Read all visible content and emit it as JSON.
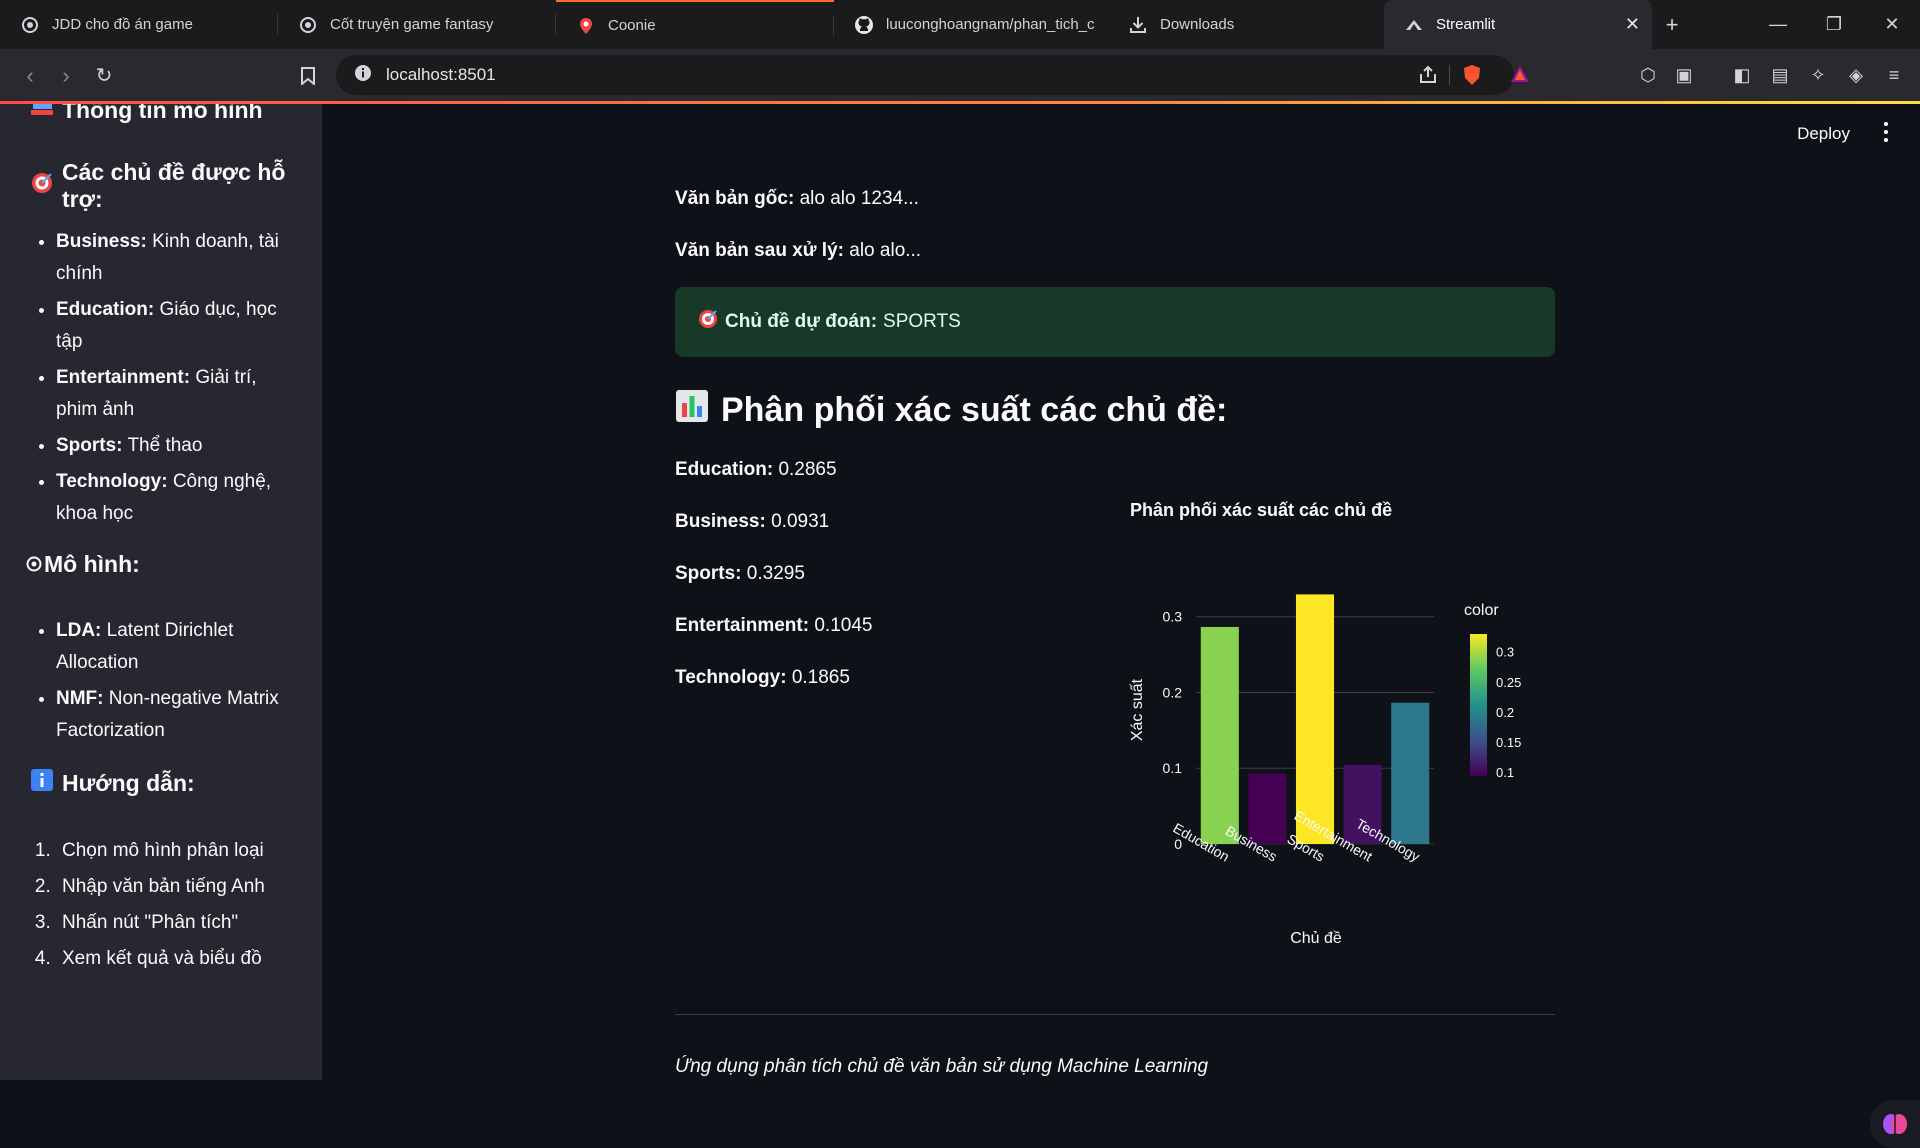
{
  "browser": {
    "tabs": [
      {
        "title": "JDD cho đồ án game",
        "icon": "circle-logo-icon"
      },
      {
        "title": "Cốt truyện game fantasy",
        "icon": "circle-logo-icon"
      },
      {
        "title": "Coonie",
        "icon": "pin-icon"
      },
      {
        "title": "luuconghoangnam/phan_tich_c",
        "icon": "github-icon"
      },
      {
        "title": "Downloads",
        "icon": "download-icon"
      },
      {
        "title": "Streamlit",
        "icon": "streamlit-icon",
        "active": true
      }
    ],
    "url": "localhost:8501"
  },
  "sidebar": {
    "model_info_heading": "Thông tin mô hình",
    "topics_heading": "Các chủ đề được hỗ trợ:",
    "topics": [
      {
        "name": "Business:",
        "desc": "Kinh doanh, tài chính"
      },
      {
        "name": "Education:",
        "desc": "Giáo dục, học tập"
      },
      {
        "name": "Entertainment:",
        "desc": "Giải trí, phim ảnh"
      },
      {
        "name": "Sports:",
        "desc": "Thể thao"
      },
      {
        "name": "Technology:",
        "desc": "Công nghệ, khoa học"
      }
    ],
    "models_heading": "Mô hình:",
    "models": [
      {
        "name": "LDA:",
        "desc": "Latent Dirichlet Allocation"
      },
      {
        "name": "NMF:",
        "desc": "Non-negative Matrix Factorization"
      }
    ],
    "guide_heading": "Hướng dẫn:",
    "guide_steps": [
      "Chọn mô hình phân loại",
      "Nhập văn bản tiếng Anh",
      "Nhấn nút \"Phân tích\"",
      "Xem kết quả và biểu đồ"
    ]
  },
  "header": {
    "deploy_label": "Deploy"
  },
  "main": {
    "original_label": "Văn bản gốc:",
    "original_value": "alo alo 1234...",
    "processed_label": "Văn bản sau xử lý:",
    "processed_value": "alo alo...",
    "prediction_label": "Chủ đề dự đoán:",
    "prediction_value": "SPORTS",
    "distribution_heading": "Phân phối xác suất các chủ đề:",
    "probabilities": [
      {
        "label": "Education:",
        "value": "0.2865"
      },
      {
        "label": "Business:",
        "value": "0.0931"
      },
      {
        "label": "Sports:",
        "value": "0.3295"
      },
      {
        "label": "Entertainment:",
        "value": "0.1045"
      },
      {
        "label": "Technology:",
        "value": "0.1865"
      }
    ],
    "footer": "Ứng dụng phân tích chủ đề văn bản sử dụng Machine Learning"
  },
  "chart_data": {
    "type": "bar",
    "title": "Phân phối xác suất các chủ đề",
    "xlabel": "Chủ đề",
    "ylabel": "Xác suất",
    "categories": [
      "Education",
      "Business",
      "Sports",
      "Entertainment",
      "Technology"
    ],
    "values": [
      0.2865,
      0.0931,
      0.3295,
      0.1045,
      0.1865
    ],
    "ylim": [
      0,
      0.33
    ],
    "yticks": [
      0,
      0.1,
      0.2,
      0.3
    ],
    "ytick_labels": [
      "0",
      "0.1",
      "0.2",
      "0.3"
    ],
    "colorbar": {
      "title": "color",
      "ticks": [
        0.1,
        0.15,
        0.2,
        0.25,
        0.3
      ],
      "tick_labels": [
        "0.1",
        "0.15",
        "0.2",
        "0.25",
        "0.3"
      ],
      "range": [
        0.0931,
        0.3295
      ],
      "colorscale": "viridis"
    },
    "grid": true
  }
}
